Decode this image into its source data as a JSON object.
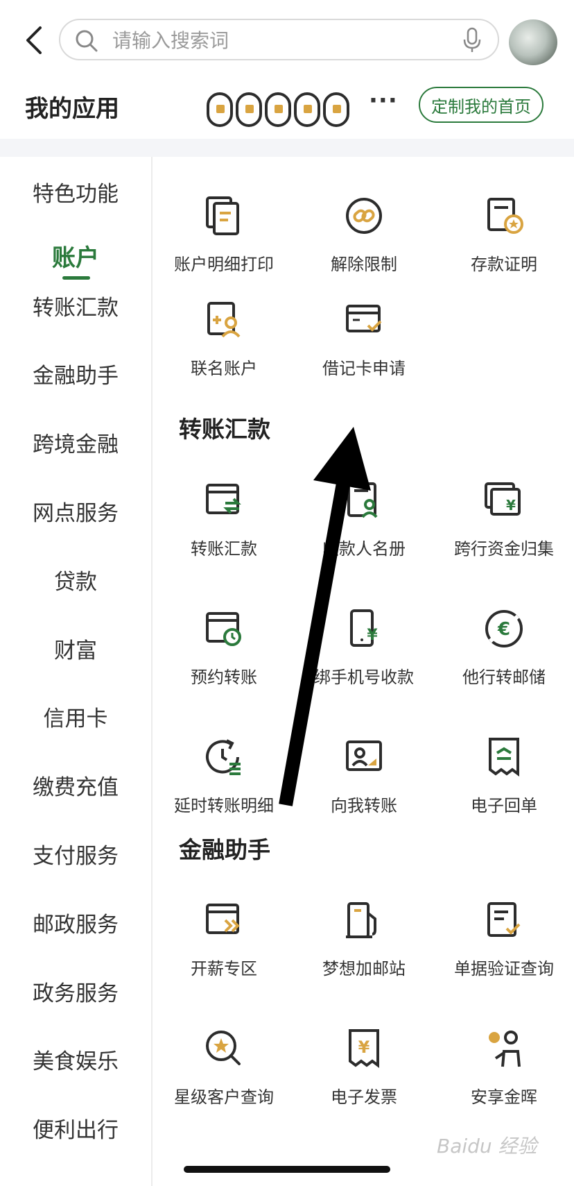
{
  "search": {
    "placeholder": "请输入搜索词"
  },
  "my_apps": {
    "title": "我的应用",
    "more": "···",
    "customize_label": "定制我的首页"
  },
  "sidebar": {
    "items": [
      {
        "label": "特色功能"
      },
      {
        "label": "账户"
      },
      {
        "label": "转账汇款"
      },
      {
        "label": "金融助手"
      },
      {
        "label": "跨境金融"
      },
      {
        "label": "网点服务"
      },
      {
        "label": "贷款"
      },
      {
        "label": "财富"
      },
      {
        "label": "信用卡"
      },
      {
        "label": "缴费充值"
      },
      {
        "label": "支付服务"
      },
      {
        "label": "邮政服务"
      },
      {
        "label": "政务服务"
      },
      {
        "label": "美食娱乐"
      },
      {
        "label": "便利出行"
      }
    ],
    "active": "账户"
  },
  "sections": {
    "account": {
      "tiles": [
        {
          "label": "账户明细打印",
          "icon": "copy-doc-icon"
        },
        {
          "label": "解除限制",
          "icon": "unlink-icon"
        },
        {
          "label": "存款证明",
          "icon": "certificate-icon"
        },
        {
          "label": "联名账户",
          "icon": "joint-account-icon"
        },
        {
          "label": "借记卡申请",
          "icon": "card-check-icon"
        }
      ]
    },
    "transfer": {
      "title": "转账汇款",
      "tiles": [
        {
          "label": "转账汇款",
          "icon": "transfer-icon"
        },
        {
          "label": "收款人名册",
          "icon": "payee-list-icon"
        },
        {
          "label": "跨行资金归集",
          "icon": "fund-collect-icon"
        },
        {
          "label": "预约转账",
          "icon": "scheduled-transfer-icon"
        },
        {
          "label": "绑手机号收款",
          "icon": "phone-receive-icon"
        },
        {
          "label": "他行转邮储",
          "icon": "bank-transfer-icon"
        },
        {
          "label": "延时转账明细",
          "icon": "delay-transfer-icon"
        },
        {
          "label": "向我转账",
          "icon": "transfer-to-me-icon"
        },
        {
          "label": "电子回单",
          "icon": "e-receipt-icon"
        }
      ]
    },
    "finance": {
      "title": "金融助手",
      "tiles": [
        {
          "label": "开薪专区",
          "icon": "salary-icon"
        },
        {
          "label": "梦想加邮站",
          "icon": "dream-station-icon"
        },
        {
          "label": "单据验证查询",
          "icon": "doc-verify-icon"
        },
        {
          "label": "星级客户查询",
          "icon": "star-search-icon"
        },
        {
          "label": "电子发票",
          "icon": "e-invoice-icon"
        },
        {
          "label": "安享金晖",
          "icon": "senior-icon"
        }
      ]
    }
  },
  "watermark": "Baidu 经验",
  "colors": {
    "brand_green": "#2b7a3c",
    "accent_gold": "#d9a441",
    "icon_dark": "#2c2c2c"
  }
}
